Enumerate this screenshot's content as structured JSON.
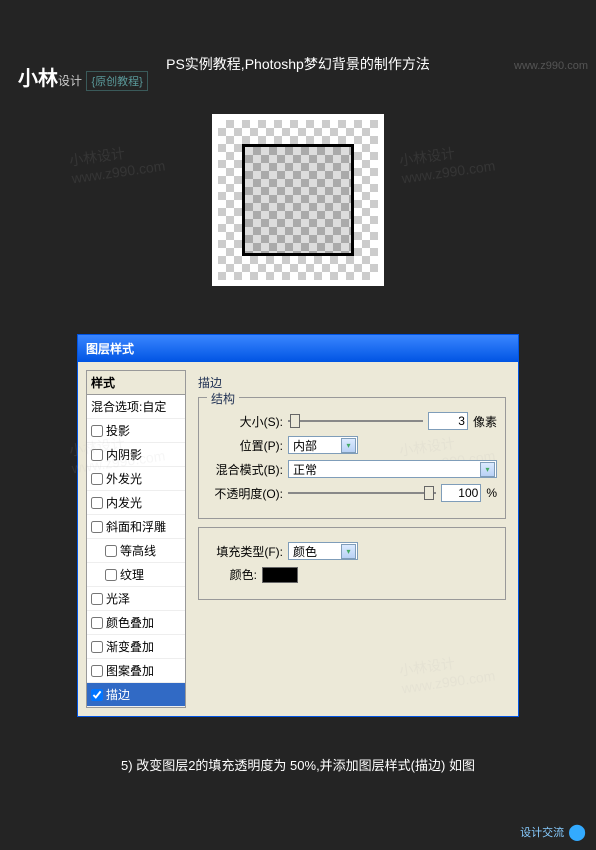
{
  "header": {
    "logo_main": "小林",
    "logo_sub": "设计",
    "original": "{原创教程}",
    "url": "www.z990.com"
  },
  "title": "PS实例教程,Photoshp梦幻背景的制作方法",
  "dialog": {
    "title": "图层样式",
    "style_header": "样式",
    "blend_opts": "混合选项:自定",
    "items": {
      "drop_shadow": "投影",
      "inner_shadow": "内阴影",
      "outer_glow": "外发光",
      "inner_glow": "内发光",
      "bevel": "斜面和浮雕",
      "contour": "等高线",
      "texture": "纹理",
      "satin": "光泽",
      "color_overlay": "颜色叠加",
      "gradient_overlay": "渐变叠加",
      "pattern_overlay": "图案叠加",
      "stroke": "描边"
    },
    "panel": {
      "section": "描边",
      "structure": "结构",
      "size_label": "大小(S):",
      "size_value": "3",
      "size_unit": "像素",
      "position_label": "位置(P):",
      "position_value": "内部",
      "blend_label": "混合模式(B):",
      "blend_value": "正常",
      "opacity_label": "不透明度(O):",
      "opacity_value": "100",
      "opacity_unit": "%",
      "fill_type_label": "填充类型(F):",
      "fill_type_value": "颜色",
      "color_label": "颜色:"
    }
  },
  "step": "5) 改变图层2的填充透明度为 50%,并添加图层样式(描边) 如图",
  "footer": "设计交流"
}
